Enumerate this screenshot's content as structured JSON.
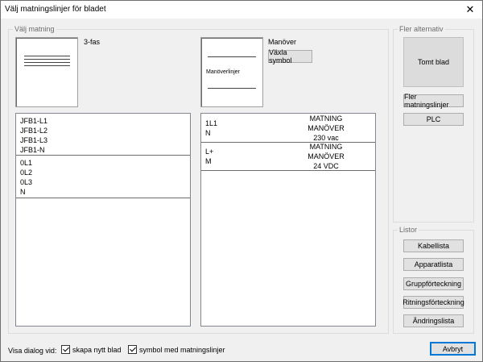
{
  "window": {
    "title": "Välj matningslinjer för bladet",
    "close_glyph": "✕"
  },
  "matning": {
    "group_label": "Välj matning",
    "preview1_label": "3-fas",
    "preview2_label": "Manöver",
    "preview2_text": "Manöverlinjer",
    "switch_symbol_label": "Växla symbol"
  },
  "left_list": [
    {
      "lines": [
        "JFB1-L1",
        "JFB1-L2",
        "JFB1-L3",
        "JFB1-N"
      ]
    },
    {
      "lines": [
        "0L1",
        "0L2",
        "0L3",
        "N"
      ]
    }
  ],
  "right_list": [
    {
      "left": [
        "1L1",
        "N"
      ],
      "center": [
        "MATNING",
        "MANÖVER",
        "230 vac"
      ]
    },
    {
      "left": [
        "L+",
        "M"
      ],
      "center": [
        "MATNING",
        "MANÖVER",
        "24 VDC"
      ]
    }
  ],
  "more_options": {
    "group_label": "Fler alternativ",
    "empty_sheet": "Tomt blad",
    "more_lines": "Fler matningslinjer",
    "plc": "PLC"
  },
  "lists": {
    "group_label": "Listor",
    "buttons": [
      "Kabellista",
      "Apparatlista",
      "Gruppförteckning",
      "Ritningsförteckning",
      "Ändringslista"
    ]
  },
  "footer": {
    "show_dialog_label": "Visa dialog vid:",
    "cb_new_sheet": "skapa nytt blad",
    "cb_symbol": "symbol med matningslinjer",
    "cancel": "Avbryt"
  }
}
